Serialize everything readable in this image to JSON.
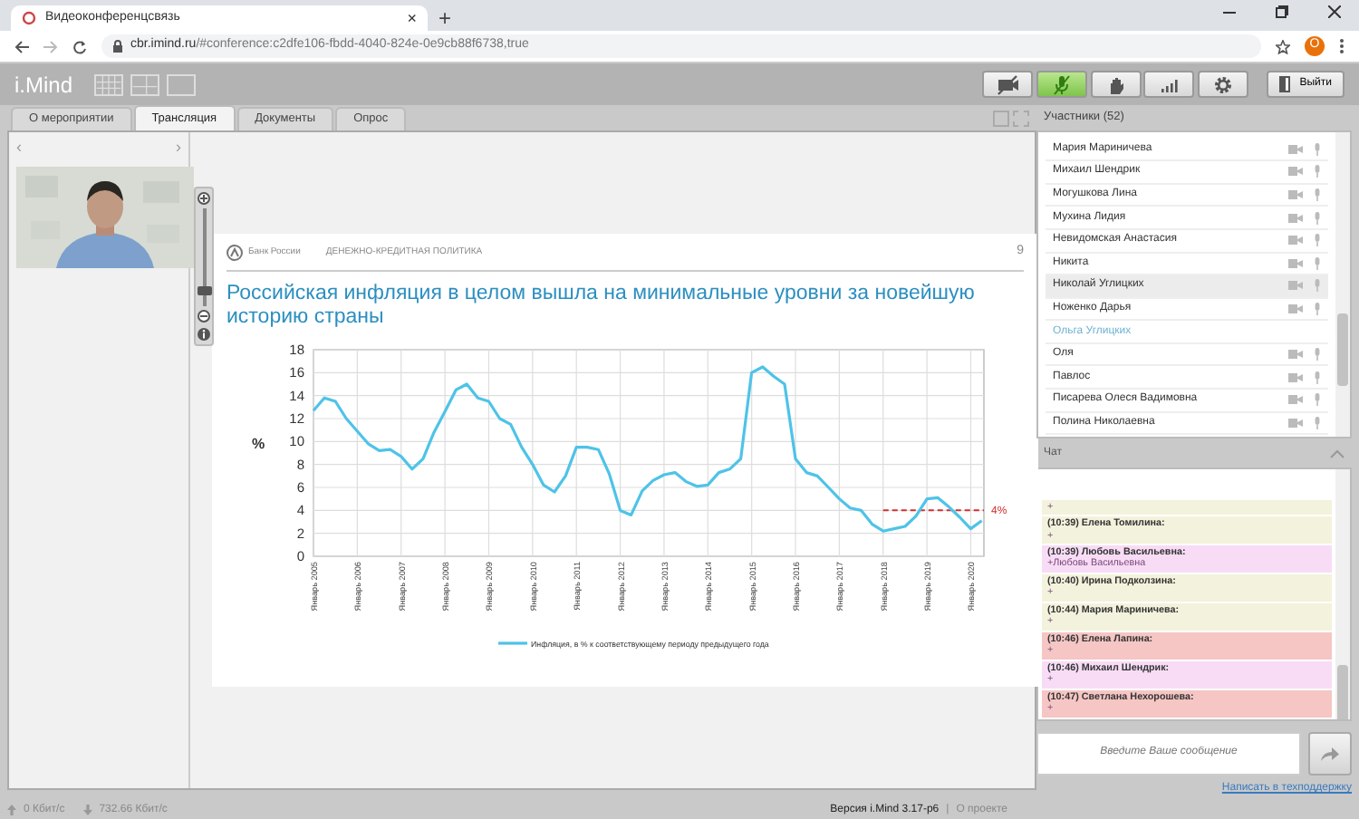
{
  "browser": {
    "tab_title": "Видеоконференцсвязь",
    "tab_close": "×",
    "new_tab": "+",
    "url_host": "cbr.imind.ru",
    "url_path": "/#conference:c2dfe106-fbdd-4040-824e-0e9cb88f6738,true",
    "avatar": "O"
  },
  "app": {
    "logo": "i.Mind",
    "toolbar": [
      {
        "kind": "camera",
        "active": false
      },
      {
        "kind": "mic",
        "active": true
      },
      {
        "kind": "hand",
        "active": false
      },
      {
        "kind": "signal",
        "active": false
      },
      {
        "kind": "settings",
        "active": false
      }
    ],
    "exit_label": "Выйти"
  },
  "tabs": [
    {
      "label": "О мероприятии",
      "selected": false
    },
    {
      "label": "Трансляция",
      "selected": true
    },
    {
      "label": "Документы",
      "selected": false
    },
    {
      "label": "Опрос",
      "selected": false
    }
  ],
  "slide": {
    "bank": "Банк России",
    "section": "ДЕНЕЖНО-КРЕДИТНАЯ ПОЛИТИКА",
    "page": "9",
    "title": "Российская инфляция в целом вышла на минимальные уровни за новейшую историю страны",
    "zoom": {
      "level": 0.12
    },
    "chart_data": {
      "type": "line",
      "ylabel": "%",
      "categories": [
        "Январь 2005",
        null,
        null,
        null,
        "Январь 2006",
        null,
        null,
        null,
        "Январь 2007",
        null,
        null,
        null,
        "Январь 2008",
        null,
        null,
        null,
        "Январь 2009",
        null,
        null,
        null,
        "Январь 2010",
        null,
        null,
        null,
        "Январь 2011",
        null,
        null,
        null,
        "Январь 2012",
        null,
        null,
        null,
        "Январь 2013",
        null,
        null,
        null,
        "Январь 2014",
        null,
        null,
        null,
        "Январь 2015",
        null,
        null,
        null,
        "Январь 2016",
        null,
        null,
        null,
        "Январь 2017",
        null,
        null,
        null,
        "Январь 2018",
        null,
        null,
        null,
        "Январь 2019",
        null,
        null,
        null,
        "Январь 2020",
        null
      ],
      "series": [
        {
          "name": "Инфляция, в % к соответствующему периоду предыдущего года",
          "color": "#4ec3e8",
          "values": [
            12.7,
            13.8,
            13.5,
            12.0,
            10.9,
            9.8,
            9.2,
            9.3,
            8.7,
            7.6,
            8.5,
            10.8,
            12.6,
            14.5,
            15.0,
            13.8,
            13.5,
            12.0,
            11.5,
            9.5,
            8.0,
            6.2,
            5.6,
            7.0,
            9.5,
            9.5,
            9.3,
            7.2,
            4.0,
            3.6,
            5.7,
            6.6,
            7.1,
            7.3,
            6.5,
            6.1,
            6.2,
            7.3,
            7.6,
            8.5,
            16.0,
            16.5,
            15.7,
            15.0,
            8.5,
            7.3,
            7.0,
            6.0,
            5.0,
            4.2,
            4.0,
            2.8,
            2.2,
            2.4,
            2.6,
            3.5,
            5.0,
            5.1,
            4.3,
            3.4,
            2.4,
            3.1
          ]
        }
      ],
      "ylim": [
        0,
        18
      ],
      "grid": true,
      "yticks": [
        0,
        2,
        4,
        6,
        8,
        10,
        12,
        14,
        16,
        18
      ],
      "annotations": [
        "4%"
      ]
    }
  },
  "video_nav": {
    "prev": "‹",
    "next": "›"
  },
  "participants": {
    "title": "Участники (52)",
    "items": [
      {
        "name": "Мария Мариничева",
        "kind": "device",
        "selected": false
      },
      {
        "name": "Михаил Шендрик",
        "kind": "device",
        "selected": false
      },
      {
        "name": "Могушкова Лина",
        "kind": "device",
        "selected": false
      },
      {
        "name": "Мухина Лидия",
        "kind": "device",
        "selected": false
      },
      {
        "name": "Невидомская Анастасия",
        "kind": "device",
        "selected": false
      },
      {
        "name": "Никита",
        "kind": "device",
        "selected": false
      },
      {
        "name": "Николай Углицких",
        "kind": "device",
        "selected": true
      },
      {
        "name": "Ноженко Дарья",
        "kind": "device",
        "selected": false
      },
      {
        "name": "Ольга Углицких",
        "kind": "self",
        "selected": false
      },
      {
        "name": "Оля",
        "kind": "device",
        "selected": false
      },
      {
        "name": "Павлос",
        "kind": "device",
        "selected": false
      },
      {
        "name": "Писарева Олеся Вадимовна",
        "kind": "device",
        "selected": false
      },
      {
        "name": "Полина Николаевна",
        "kind": "device",
        "selected": false
      }
    ]
  },
  "chat": {
    "title": "Чат",
    "messages": [
      {
        "text": "+",
        "color": "#f3f2dc"
      },
      {
        "header": "(10:39) Елена Томилина:",
        "text": "+",
        "color": "#f3f2dc"
      },
      {
        "header": "(10:39) Любовь Васильевна:",
        "text": "+Любовь Васильевна",
        "color": "#f8dcf6"
      },
      {
        "header": "(10:40) Ирина Подколзина:",
        "text": "+",
        "color": "#f3f2dc"
      },
      {
        "header": "(10:44) Мария Мариничева:",
        "text": "+",
        "color": "#f3f2dc"
      },
      {
        "header": "(10:46) Елена Лапина:",
        "text": "+",
        "color": "#f5c6c4"
      },
      {
        "header": "(10:46) Михаил Шендрик:",
        "text": "+",
        "color": "#f8dcf6"
      },
      {
        "header": "(10:47) Светлана Нехорошева:",
        "text": "+",
        "color": "#f5c6c4"
      }
    ],
    "placeholder": "Введите Ваше сообщение",
    "support_link": "Написать в техподдержку"
  },
  "footer": {
    "upload": "0 Кбит/с",
    "download": "732.66 Кбит/с",
    "version": "Версия i.Mind 3.17-p6",
    "separator": "|",
    "about_link": "О проекте"
  }
}
